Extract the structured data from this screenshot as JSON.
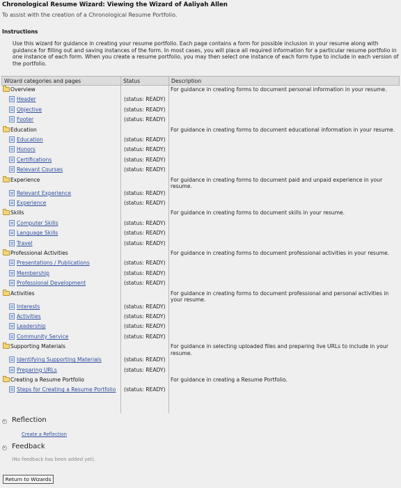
{
  "header": {
    "title": "Chronological Resume Wizard: Viewing the Wizard of Aaliyah Allen",
    "subtitle": "To assist with the creation of a Chronological Resume Portfolio."
  },
  "instructions": {
    "heading": "Instructions",
    "text": "Use this wizard for guidance in creating your resume portfolio. Each page contains a form for possible inclusion in your resume along with guidance for filling out and saving instances of the form. In most cases, you will place all required information for a particular resume portfolio in one instance of each form. When you create a resume portfolio, you may then select one instance of each form type to include in each version of the portfolio."
  },
  "table": {
    "columns": [
      "Wizard categories and pages",
      "Status",
      "Description"
    ],
    "categories": [
      {
        "label": "Overview",
        "description": "For guidance in creating forms to document personal information in your resume.",
        "pages": [
          {
            "label": "Header",
            "status": "(status: READY)"
          },
          {
            "label": "Objective",
            "status": "(status: READY)"
          },
          {
            "label": "Footer",
            "status": "(status: READY)"
          }
        ]
      },
      {
        "label": "Education",
        "description": "For guidance in creating forms to document educational information in your resume.",
        "pages": [
          {
            "label": "Education",
            "status": "(status: READY)"
          },
          {
            "label": "Honors",
            "status": "(status: READY)"
          },
          {
            "label": "Certifications",
            "status": "(status: READY)"
          },
          {
            "label": "Relevant Courses",
            "status": "(status: READY)"
          }
        ]
      },
      {
        "label": "Experience",
        "description": "For guidance in creating forms to document paid and unpaid experience in your resume.",
        "pages": [
          {
            "label": "Relevant Experience",
            "status": "(status: READY)"
          },
          {
            "label": "Experience",
            "status": "(status: READY)"
          }
        ]
      },
      {
        "label": "Skills",
        "description": "For guidance in creating forms to document skills in your resume.",
        "pages": [
          {
            "label": "Computer Skills",
            "status": "(status: READY)"
          },
          {
            "label": "Language Skills",
            "status": "(status: READY)"
          },
          {
            "label": "Travel",
            "status": "(status: READY)"
          }
        ]
      },
      {
        "label": "Professional Activities",
        "description": "For guidance in creating forms to document professional activities in your resume.",
        "pages": [
          {
            "label": "Presentations / Publications",
            "status": "(status: READY)"
          },
          {
            "label": "Membership",
            "status": "(status: READY)"
          },
          {
            "label": "Professional Development",
            "status": "(status: READY)"
          }
        ]
      },
      {
        "label": "Activities",
        "description": "For guidance in creating forms to document professional and personal activities in your resume.",
        "pages": [
          {
            "label": "Interests",
            "status": "(status: READY)"
          },
          {
            "label": "Activities",
            "status": "(status: READY)"
          },
          {
            "label": "Leadership",
            "status": "(status: READY)"
          },
          {
            "label": "Community Service",
            "status": "(status: READY)"
          }
        ]
      },
      {
        "label": "Supporting Materials",
        "description": "For guidance in selecting uploaded files and preparing live URLs to include in your resume.",
        "pages": [
          {
            "label": "Identifying Supporting Materials",
            "status": "(status: READY)"
          },
          {
            "label": "Preparing URLs",
            "status": "(status: READY)"
          }
        ]
      },
      {
        "label": "Creating a Resume Portfolio",
        "description": "For guidance in creating a Resume Portfolio.",
        "pages": [
          {
            "label": "Steps for Creating a Resume Portfolio",
            "status": "(status: READY)"
          }
        ]
      }
    ]
  },
  "reflection": {
    "heading": "Reflection",
    "link": "Create a Reflection"
  },
  "feedback": {
    "heading": "Feedback",
    "empty_text": "(No feedback has been added yet)."
  },
  "footer": {
    "return_button": "Return to Wizards"
  },
  "colors": {
    "background": "#efefef",
    "link": "#2d4f9e",
    "header_bar": "#dcdcdc"
  }
}
